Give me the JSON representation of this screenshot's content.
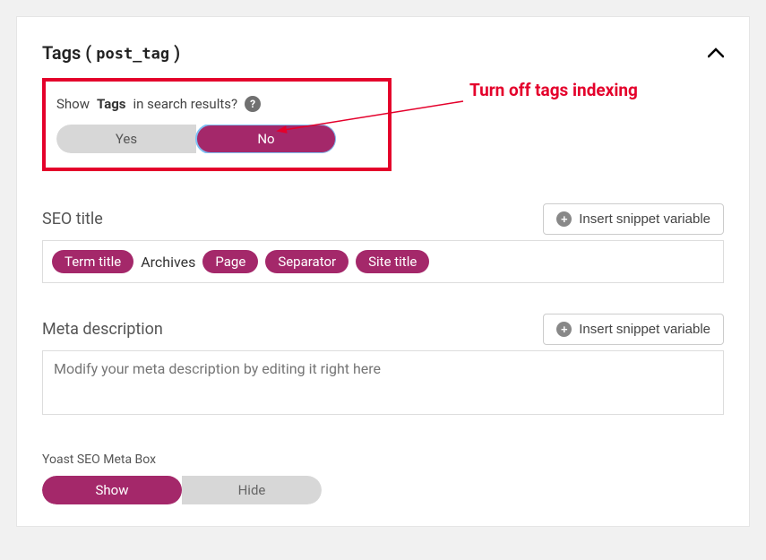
{
  "header": {
    "title_prefix": "Tags",
    "title_paren_open": " ( ",
    "title_code": "post_tag",
    "title_paren_close": " )"
  },
  "question": {
    "prefix": "Show ",
    "bold": "Tags",
    "suffix": " in search results?"
  },
  "toggle_search": {
    "yes": "Yes",
    "no": "No",
    "selected": "no"
  },
  "annotation": "Turn off tags indexing",
  "seo_title": {
    "label": "SEO title",
    "insert_button": "Insert snippet variable",
    "tokens": [
      {
        "text": "Term title",
        "type": "pill"
      },
      {
        "text": "Archives",
        "type": "text"
      },
      {
        "text": "Page",
        "type": "pill"
      },
      {
        "text": "Separator",
        "type": "pill"
      },
      {
        "text": "Site title",
        "type": "pill"
      }
    ]
  },
  "meta_desc": {
    "label": "Meta description",
    "insert_button": "Insert snippet variable",
    "placeholder": "Modify your meta description by editing it right here"
  },
  "yoast_metabox": {
    "label": "Yoast SEO Meta Box",
    "show": "Show",
    "hide": "Hide",
    "selected": "show"
  },
  "colors": {
    "accent": "#a4286a",
    "annotation": "#e4002b"
  }
}
